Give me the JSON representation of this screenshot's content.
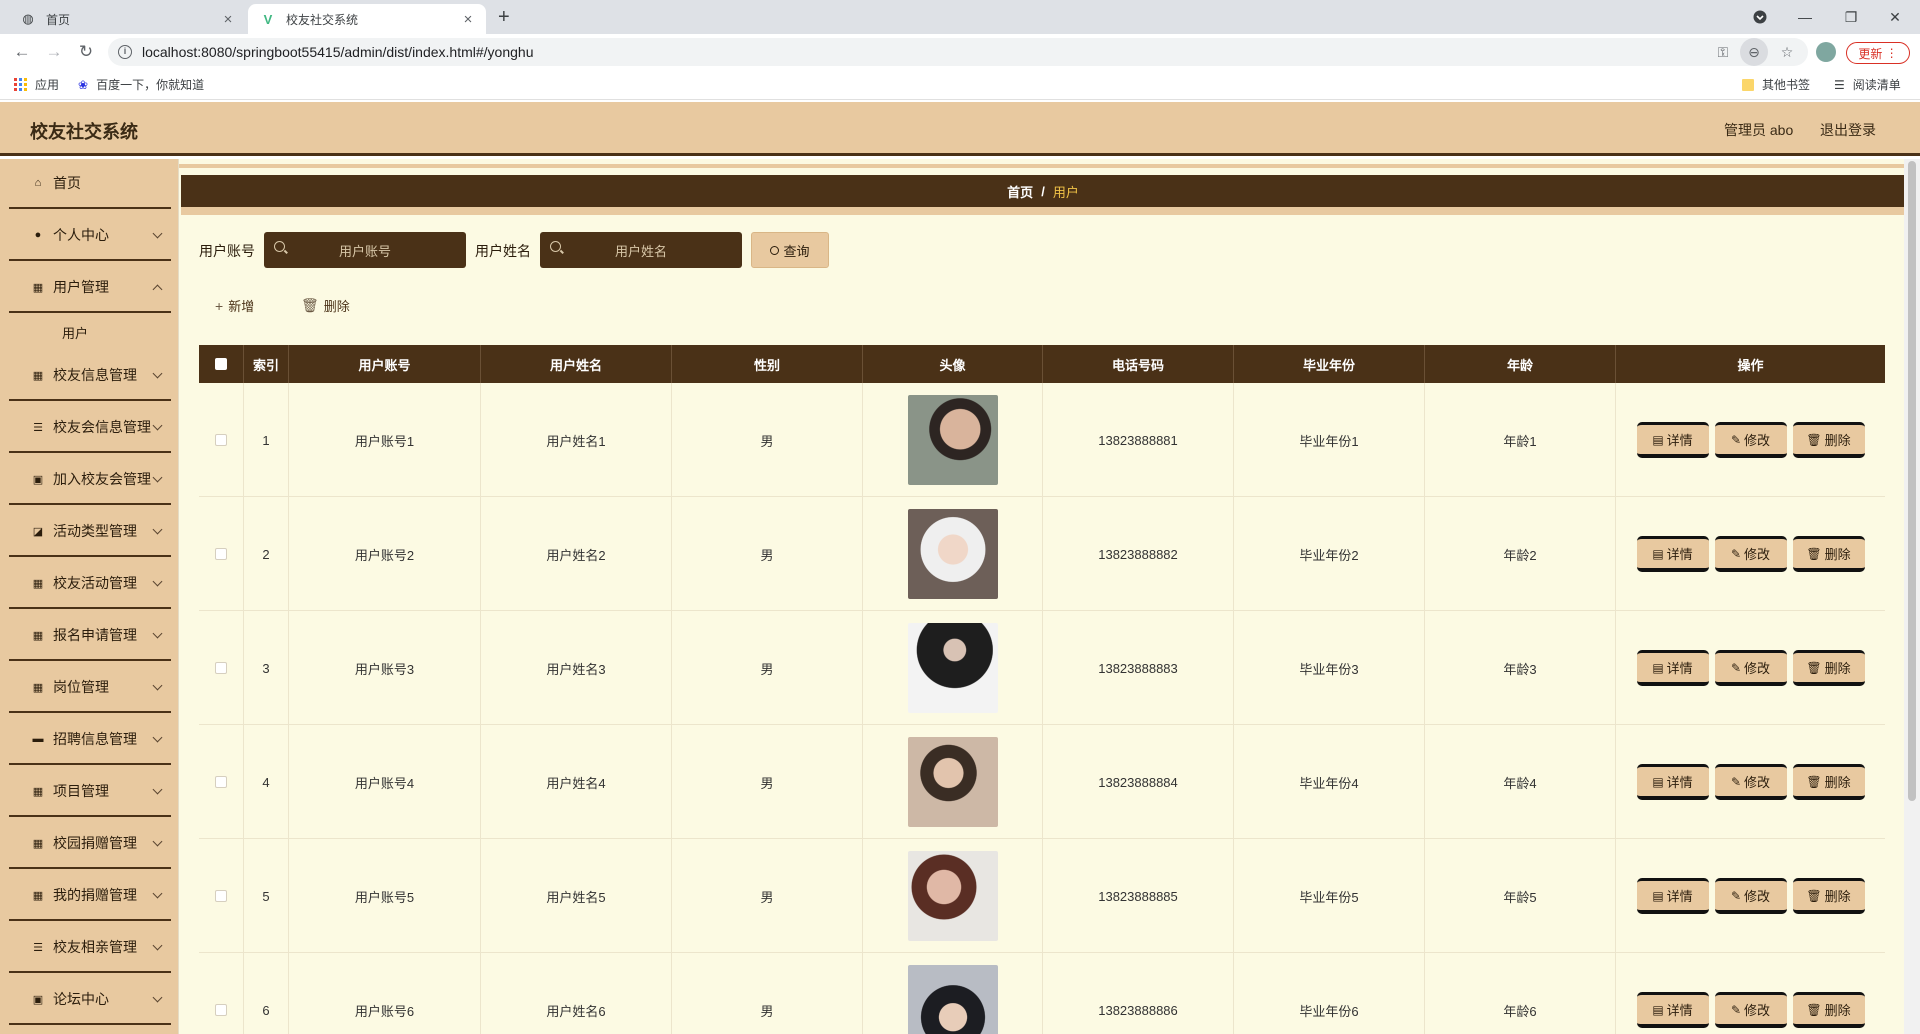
{
  "browser": {
    "tabs": [
      {
        "title": "首页",
        "icon": "globe-icon"
      },
      {
        "title": "校友社交系统",
        "icon": "vue-logo-icon"
      }
    ],
    "url": "localhost:8080/springboot55415/admin/dist/index.html#/yonghu",
    "update_label": "更新",
    "bookmarks": {
      "apps": "应用",
      "baidu": "百度一下，你就知道",
      "other": "其他书签",
      "reading": "阅读清单"
    }
  },
  "header": {
    "title": "校友社交系统",
    "user": "管理员 abo",
    "logout": "退出登录"
  },
  "sidebar": {
    "items": [
      {
        "label": "首页",
        "icon": "home-icon",
        "chevron": false
      },
      {
        "label": "个人中心",
        "icon": "person-icon",
        "chevron": true
      },
      {
        "label": "用户管理",
        "icon": "grid-icon",
        "chevron": true
      },
      {
        "label": "校友信息管理",
        "icon": "grid-icon",
        "chevron": true
      },
      {
        "label": "校友会信息管理",
        "icon": "list-icon",
        "chevron": true
      },
      {
        "label": "加入校友会管理",
        "icon": "clipboard-icon",
        "chevron": true
      },
      {
        "label": "活动类型管理",
        "icon": "bus-icon",
        "chevron": true
      },
      {
        "label": "校友活动管理",
        "icon": "grid-icon",
        "chevron": true
      },
      {
        "label": "报名申请管理",
        "icon": "grid-icon",
        "chevron": true
      },
      {
        "label": "岗位管理",
        "icon": "grid-icon",
        "chevron": true
      },
      {
        "label": "招聘信息管理",
        "icon": "monitor-icon",
        "chevron": true
      },
      {
        "label": "项目管理",
        "icon": "grid-icon",
        "chevron": true
      },
      {
        "label": "校园捐赠管理",
        "icon": "grid-icon",
        "chevron": true
      },
      {
        "label": "我的捐赠管理",
        "icon": "grid-icon",
        "chevron": true
      },
      {
        "label": "校友相亲管理",
        "icon": "list-icon",
        "chevron": true
      },
      {
        "label": "论坛中心",
        "icon": "clipboard-icon",
        "chevron": true
      }
    ],
    "submenu_label": "用户"
  },
  "breadcrumb": {
    "home": "首页",
    "separator": "/",
    "current": "用户"
  },
  "search": {
    "account_label": "用户账号",
    "account_placeholder": "用户账号",
    "name_label": "用户姓名",
    "name_placeholder": "用户姓名",
    "query_label": "查询"
  },
  "actions": {
    "add": "新增",
    "delete": "删除"
  },
  "table": {
    "columns": [
      "索引",
      "用户账号",
      "用户姓名",
      "性别",
      "头像",
      "电话号码",
      "毕业年份",
      "年龄",
      "操作"
    ],
    "op_labels": {
      "detail": "详情",
      "edit": "修改",
      "delete": "删除"
    },
    "rows": [
      {
        "index": "1",
        "account": "用户账号1",
        "name": "用户姓名1",
        "gender": "男",
        "phone": "13823888881",
        "year": "毕业年份1",
        "age": "年龄1"
      },
      {
        "index": "2",
        "account": "用户账号2",
        "name": "用户姓名2",
        "gender": "男",
        "phone": "13823888882",
        "year": "毕业年份2",
        "age": "年龄2"
      },
      {
        "index": "3",
        "account": "用户账号3",
        "name": "用户姓名3",
        "gender": "男",
        "phone": "13823888883",
        "year": "毕业年份3",
        "age": "年龄3"
      },
      {
        "index": "4",
        "account": "用户账号4",
        "name": "用户姓名4",
        "gender": "男",
        "phone": "13823888884",
        "year": "毕业年份4",
        "age": "年龄4"
      },
      {
        "index": "5",
        "account": "用户账号5",
        "name": "用户姓名5",
        "gender": "男",
        "phone": "13823888885",
        "year": "毕业年份5",
        "age": "年龄5"
      },
      {
        "index": "6",
        "account": "用户账号6",
        "name": "用户姓名6",
        "gender": "男",
        "phone": "13823888886",
        "year": "毕业年份6",
        "age": "年龄6"
      }
    ]
  },
  "colors": {
    "accent": "#4a3117",
    "tan": "#e8c9a0",
    "content_bg": "#fcfae3",
    "breadcrumb_current": "#f3c447"
  }
}
